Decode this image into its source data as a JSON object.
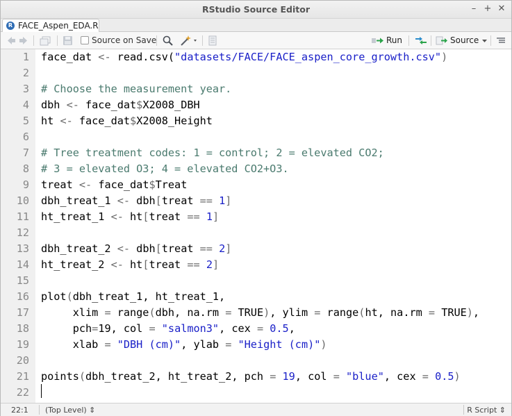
{
  "window": {
    "title": "RStudio Source Editor",
    "controls": [
      "–",
      "+",
      "✕"
    ]
  },
  "tab": {
    "label": "FACE_Aspen_EDA.R",
    "icon_text": "R"
  },
  "toolbar": {
    "source_on_save_label": "Source on Save",
    "run_label": "Run",
    "source_label": "Source"
  },
  "editor": {
    "lines": [
      {
        "n": "1",
        "tokens": [
          {
            "t": "face_dat ",
            "c": "plain"
          },
          {
            "t": "<-",
            "c": "op"
          },
          {
            "t": " read.csv(",
            "c": "plain"
          },
          {
            "t": "\"datasets/FACE/FACE_aspen_core_growth.csv\"",
            "c": "str"
          },
          {
            "t": ")",
            "c": "op"
          }
        ]
      },
      {
        "n": "2",
        "tokens": []
      },
      {
        "n": "3",
        "tokens": [
          {
            "t": "# Choose the measurement year.",
            "c": "com"
          }
        ]
      },
      {
        "n": "4",
        "tokens": [
          {
            "t": "dbh ",
            "c": "plain"
          },
          {
            "t": "<-",
            "c": "op"
          },
          {
            "t": " face_dat",
            "c": "plain"
          },
          {
            "t": "$",
            "c": "op"
          },
          {
            "t": "X2008_DBH",
            "c": "plain"
          }
        ]
      },
      {
        "n": "5",
        "tokens": [
          {
            "t": "ht ",
            "c": "plain"
          },
          {
            "t": "<-",
            "c": "op"
          },
          {
            "t": " face_dat",
            "c": "plain"
          },
          {
            "t": "$",
            "c": "op"
          },
          {
            "t": "X2008_Height",
            "c": "plain"
          }
        ]
      },
      {
        "n": "6",
        "tokens": []
      },
      {
        "n": "7",
        "tokens": [
          {
            "t": "# Tree treatment codes: 1 = control; 2 = elevated CO2;",
            "c": "com"
          }
        ]
      },
      {
        "n": "8",
        "tokens": [
          {
            "t": "# 3 = elevated O3; 4 = elevated CO2+O3.",
            "c": "com"
          }
        ]
      },
      {
        "n": "9",
        "tokens": [
          {
            "t": "treat ",
            "c": "plain"
          },
          {
            "t": "<-",
            "c": "op"
          },
          {
            "t": " face_dat",
            "c": "plain"
          },
          {
            "t": "$",
            "c": "op"
          },
          {
            "t": "Treat",
            "c": "plain"
          }
        ]
      },
      {
        "n": "10",
        "tokens": [
          {
            "t": "dbh_treat_1 ",
            "c": "plain"
          },
          {
            "t": "<-",
            "c": "op"
          },
          {
            "t": " dbh",
            "c": "plain"
          },
          {
            "t": "[",
            "c": "op"
          },
          {
            "t": "treat ",
            "c": "plain"
          },
          {
            "t": "==",
            "c": "op"
          },
          {
            "t": " ",
            "c": "plain"
          },
          {
            "t": "1",
            "c": "num"
          },
          {
            "t": "]",
            "c": "op"
          }
        ]
      },
      {
        "n": "11",
        "tokens": [
          {
            "t": "ht_treat_1 ",
            "c": "plain"
          },
          {
            "t": "<-",
            "c": "op"
          },
          {
            "t": " ht",
            "c": "plain"
          },
          {
            "t": "[",
            "c": "op"
          },
          {
            "t": "treat ",
            "c": "plain"
          },
          {
            "t": "==",
            "c": "op"
          },
          {
            "t": " ",
            "c": "plain"
          },
          {
            "t": "1",
            "c": "num"
          },
          {
            "t": "]",
            "c": "op"
          }
        ]
      },
      {
        "n": "12",
        "tokens": []
      },
      {
        "n": "13",
        "tokens": [
          {
            "t": "dbh_treat_2 ",
            "c": "plain"
          },
          {
            "t": "<-",
            "c": "op"
          },
          {
            "t": " dbh",
            "c": "plain"
          },
          {
            "t": "[",
            "c": "op"
          },
          {
            "t": "treat ",
            "c": "plain"
          },
          {
            "t": "==",
            "c": "op"
          },
          {
            "t": " ",
            "c": "plain"
          },
          {
            "t": "2",
            "c": "num"
          },
          {
            "t": "]",
            "c": "op"
          }
        ]
      },
      {
        "n": "14",
        "tokens": [
          {
            "t": "ht_treat_2 ",
            "c": "plain"
          },
          {
            "t": "<-",
            "c": "op"
          },
          {
            "t": " ht",
            "c": "plain"
          },
          {
            "t": "[",
            "c": "op"
          },
          {
            "t": "treat ",
            "c": "plain"
          },
          {
            "t": "==",
            "c": "op"
          },
          {
            "t": " ",
            "c": "plain"
          },
          {
            "t": "2",
            "c": "num"
          },
          {
            "t": "]",
            "c": "op"
          }
        ]
      },
      {
        "n": "15",
        "tokens": []
      },
      {
        "n": "16",
        "tokens": [
          {
            "t": "plot",
            "c": "plain"
          },
          {
            "t": "(",
            "c": "op"
          },
          {
            "t": "dbh_treat_1, ht_treat_1,",
            "c": "plain"
          }
        ]
      },
      {
        "n": "17",
        "tokens": [
          {
            "t": "     xlim ",
            "c": "plain"
          },
          {
            "t": "=",
            "c": "op"
          },
          {
            "t": " range",
            "c": "plain"
          },
          {
            "t": "(",
            "c": "op"
          },
          {
            "t": "dbh, na.rm ",
            "c": "plain"
          },
          {
            "t": "=",
            "c": "op"
          },
          {
            "t": " TRUE",
            "c": "plain"
          },
          {
            "t": ")",
            "c": "op"
          },
          {
            "t": ", ylim ",
            "c": "plain"
          },
          {
            "t": "=",
            "c": "op"
          },
          {
            "t": " range",
            "c": "plain"
          },
          {
            "t": "(",
            "c": "op"
          },
          {
            "t": "ht, na.rm ",
            "c": "plain"
          },
          {
            "t": "=",
            "c": "op"
          },
          {
            "t": " TRUE",
            "c": "plain"
          },
          {
            "t": ")",
            "c": "op"
          },
          {
            "t": ",",
            "c": "plain"
          }
        ]
      },
      {
        "n": "18",
        "tokens": [
          {
            "t": "     pch",
            "c": "plain"
          },
          {
            "t": "=",
            "c": "op"
          },
          {
            "t": "19, col ",
            "c": "plain"
          },
          {
            "t": "=",
            "c": "op"
          },
          {
            "t": " ",
            "c": "plain"
          },
          {
            "t": "\"salmon3\"",
            "c": "str"
          },
          {
            "t": ", cex ",
            "c": "plain"
          },
          {
            "t": "=",
            "c": "op"
          },
          {
            "t": " ",
            "c": "plain"
          },
          {
            "t": "0.5",
            "c": "num"
          },
          {
            "t": ",",
            "c": "plain"
          }
        ]
      },
      {
        "n": "19",
        "tokens": [
          {
            "t": "     xlab ",
            "c": "plain"
          },
          {
            "t": "=",
            "c": "op"
          },
          {
            "t": " ",
            "c": "plain"
          },
          {
            "t": "\"DBH (cm)\"",
            "c": "str"
          },
          {
            "t": ", ylab ",
            "c": "plain"
          },
          {
            "t": "=",
            "c": "op"
          },
          {
            "t": " ",
            "c": "plain"
          },
          {
            "t": "\"Height (cm)\"",
            "c": "str"
          },
          {
            "t": ")",
            "c": "op"
          }
        ]
      },
      {
        "n": "20",
        "tokens": []
      },
      {
        "n": "21",
        "tokens": [
          {
            "t": "points",
            "c": "plain"
          },
          {
            "t": "(",
            "c": "op"
          },
          {
            "t": "dbh_treat_2, ht_treat_2, pch ",
            "c": "plain"
          },
          {
            "t": "=",
            "c": "op"
          },
          {
            "t": " ",
            "c": "plain"
          },
          {
            "t": "19",
            "c": "num"
          },
          {
            "t": ", col ",
            "c": "plain"
          },
          {
            "t": "=",
            "c": "op"
          },
          {
            "t": " ",
            "c": "plain"
          },
          {
            "t": "\"blue\"",
            "c": "str"
          },
          {
            "t": ", cex ",
            "c": "plain"
          },
          {
            "t": "=",
            "c": "op"
          },
          {
            "t": " ",
            "c": "plain"
          },
          {
            "t": "0.5",
            "c": "num"
          },
          {
            "t": ")",
            "c": "op"
          }
        ]
      },
      {
        "n": "22",
        "tokens": []
      }
    ]
  },
  "statusbar": {
    "position": "22:1",
    "scope": "(Top Level) ⇕",
    "language": "R Script ⇕"
  },
  "colors": {
    "comment": "#4a7a6e",
    "string": "#1a20c8",
    "operator": "#6a6a6a",
    "run_arrow": "#2aa34a"
  }
}
